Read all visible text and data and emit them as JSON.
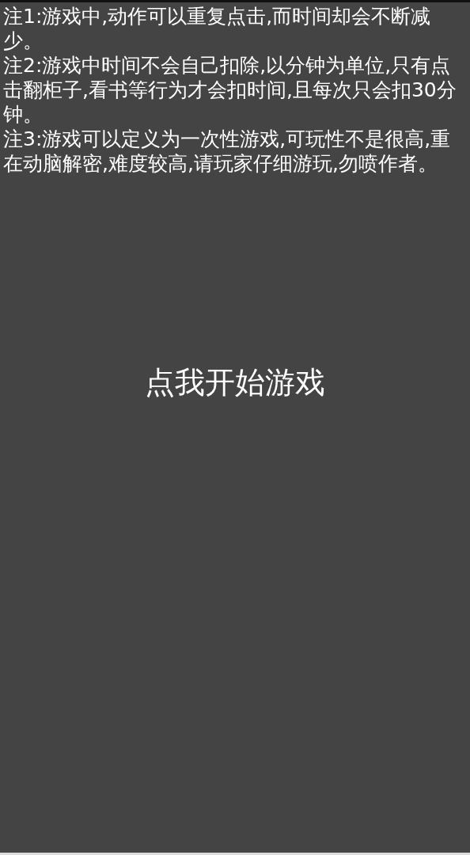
{
  "notes": [
    "注1:游戏中,动作可以重复点击,而时间却会不断减少。",
    "注2:游戏中时间不会自己扣除,以分钟为单位,只有点击翻柜子,看书等行为才会扣时间,且每次只会扣30分钟。",
    "注3:游戏可以定义为一次性游戏,可玩性不是很高,重在动脑解密,难度较高,请玩家仔细游玩,勿喷作者。"
  ],
  "start_button": {
    "label": "点我开始游戏"
  }
}
